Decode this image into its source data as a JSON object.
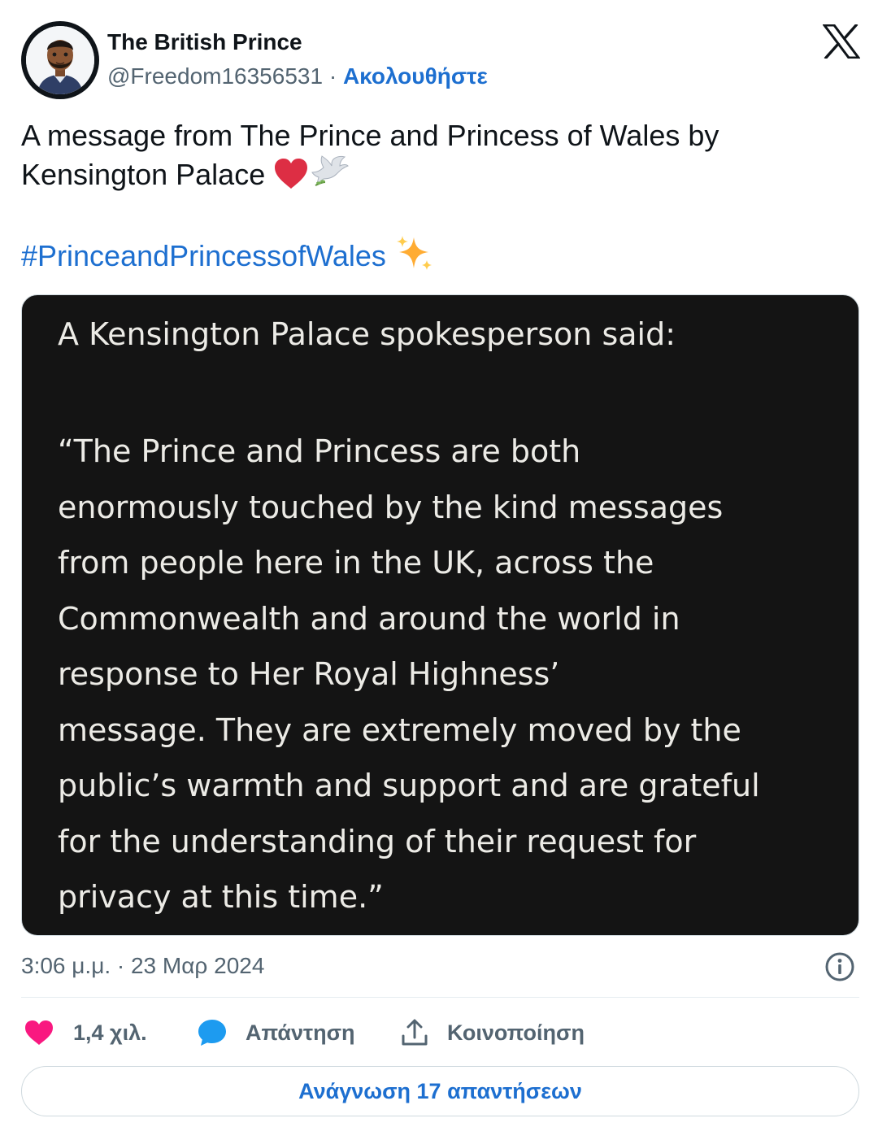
{
  "author": {
    "display_name": "The British Prince",
    "handle": "@Freedom16356531",
    "separator": "·",
    "follow_label": "Ακολουθήστε",
    "avatar_icon": "memoji-avatar-icon"
  },
  "brand": {
    "logo_icon": "x-logo-icon"
  },
  "tweet": {
    "text_lines": [
      "A message from The Prince and Princess of Wales by",
      "Kensington Palace"
    ],
    "text_emojis": [
      "red-heart-icon",
      "dove-icon"
    ],
    "hashtag": "#PrinceandPrincessofWales",
    "hashtag_emoji": "sparkles-icon"
  },
  "media": {
    "heading": "A Kensington Palace spokesperson said:",
    "quote_lines": [
      "“The Prince and Princess are both",
      "enormously touched by the kind messages",
      "from people here in the UK, across the",
      "Commonwealth and around the world in",
      "response to Her Royal Highness’",
      "message. They are extremely moved by the",
      "public’s warmth and support and are grateful",
      "for the understanding of their request for",
      "privacy at this time.”"
    ]
  },
  "meta": {
    "timestamp": "3:06 μ.μ. · 23 Μαρ 2024",
    "info_icon": "info-icon"
  },
  "actions": {
    "like_count": "1,4 χιλ.",
    "reply_label": "Απάντηση",
    "share_label": "Κοινοποίηση"
  },
  "read_replies_label": "Ανάγνωση 17 απαντήσεων",
  "colors": {
    "link": "#1d6fd0",
    "like": "#f91880",
    "reply": "#1d9bf0",
    "muted": "#536471",
    "media_bg": "#141414"
  }
}
